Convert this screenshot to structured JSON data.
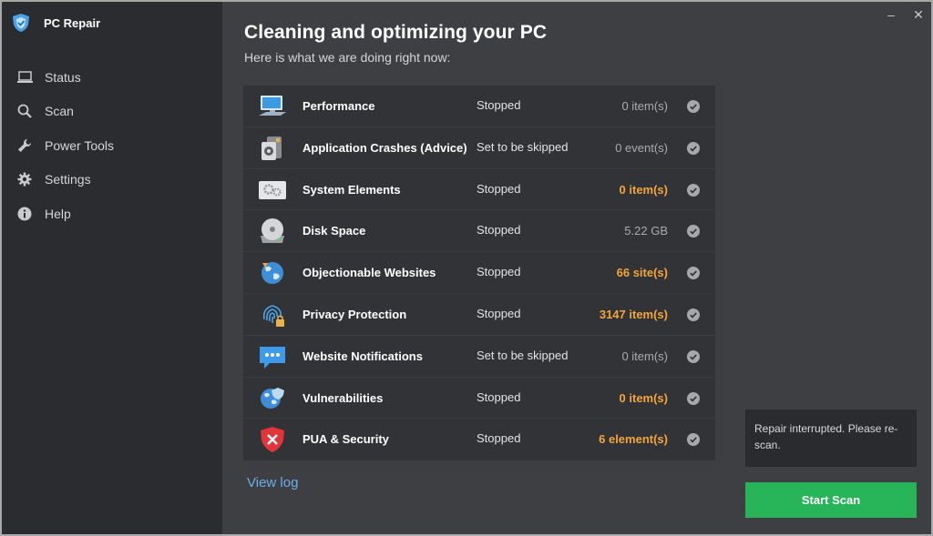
{
  "app": {
    "title": "PC Repair",
    "logo_icon": "shield-logo-icon",
    "window_controls": {
      "minimize": "–",
      "close": "✕"
    }
  },
  "sidebar": {
    "items": [
      {
        "label": "Status",
        "icon": "laptop-icon"
      },
      {
        "label": "Scan",
        "icon": "search-icon"
      },
      {
        "label": "Power Tools",
        "icon": "wrench-icon"
      },
      {
        "label": "Settings",
        "icon": "gear-icon"
      },
      {
        "label": "Help",
        "icon": "info-icon"
      }
    ]
  },
  "main": {
    "title": "Cleaning and optimizing your PC",
    "subtitle": "Here is what we are doing right now:",
    "view_log": "View log"
  },
  "scan_rows": [
    {
      "name": "Performance",
      "status": "Stopped",
      "count": "0 item(s)",
      "highlight": false,
      "icon": "monitor-icon"
    },
    {
      "name": "Application Crashes (Advice)",
      "status": "Set to be skipped",
      "count": "0 event(s)",
      "highlight": false,
      "icon": "app-crash-icon"
    },
    {
      "name": "System Elements",
      "status": "Stopped",
      "count": "0 item(s)",
      "highlight": true,
      "icon": "gears-icon"
    },
    {
      "name": "Disk Space",
      "status": "Stopped",
      "count": "5.22 GB",
      "highlight": false,
      "icon": "disk-icon"
    },
    {
      "name": "Objectionable Websites",
      "status": "Stopped",
      "count": "66 site(s)",
      "highlight": true,
      "icon": "globe-warning-icon"
    },
    {
      "name": "Privacy Protection",
      "status": "Stopped",
      "count": "3147 item(s)",
      "highlight": true,
      "icon": "fingerprint-lock-icon"
    },
    {
      "name": "Website Notifications",
      "status": "Set to be skipped",
      "count": "0 item(s)",
      "highlight": false,
      "icon": "chat-bubble-icon"
    },
    {
      "name": "Vulnerabilities",
      "status": "Stopped",
      "count": "0 item(s)",
      "highlight": true,
      "icon": "globe-shield-icon"
    },
    {
      "name": "PUA & Security",
      "status": "Stopped",
      "count": "6 element(s)",
      "highlight": true,
      "icon": "red-shield-x-icon"
    }
  ],
  "notice": {
    "text": "Repair interrupted. Please re-scan."
  },
  "actions": {
    "start_scan": "Start Scan"
  },
  "colors": {
    "sidebar_bg": "#2b2c2f",
    "main_bg": "#3e3f42",
    "table_bg": "#323336",
    "warn": "#f2a53a",
    "accent_green": "#28b55a",
    "link": "#6aaee8"
  }
}
